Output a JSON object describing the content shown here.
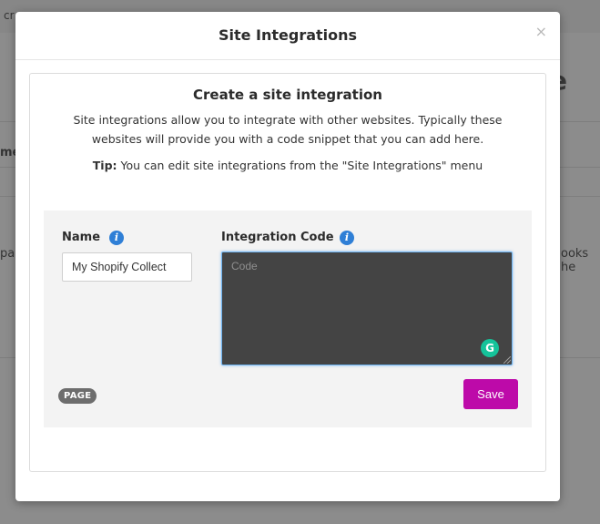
{
  "background": {
    "crumb_fragment": "cr",
    "heading_fragment": "e",
    "column_fragment": "me",
    "row_left_fragment": "pa",
    "row_right_fragment": "ooks he"
  },
  "modal": {
    "title": "Site Integrations",
    "close_glyph": "×"
  },
  "panel": {
    "heading": "Create a site integration",
    "description": "Site integrations allow you to integrate with other websites. Typically these websites will provide you with a code snippet that you can add here.",
    "tip_label": "Tip:",
    "tip_text": " You can edit site integrations from the \"Site Integrations\" menu"
  },
  "form": {
    "name_label": "Name",
    "name_value": "My Shopify Collect",
    "code_label": "Integration Code",
    "code_placeholder": "Code",
    "info_glyph": "i",
    "grammarly_glyph": "G",
    "badge": "PAGE",
    "save_label": "Save"
  },
  "colors": {
    "accent": "#bd0aa9",
    "info": "#2f7fd6",
    "code_bg": "#444444"
  }
}
